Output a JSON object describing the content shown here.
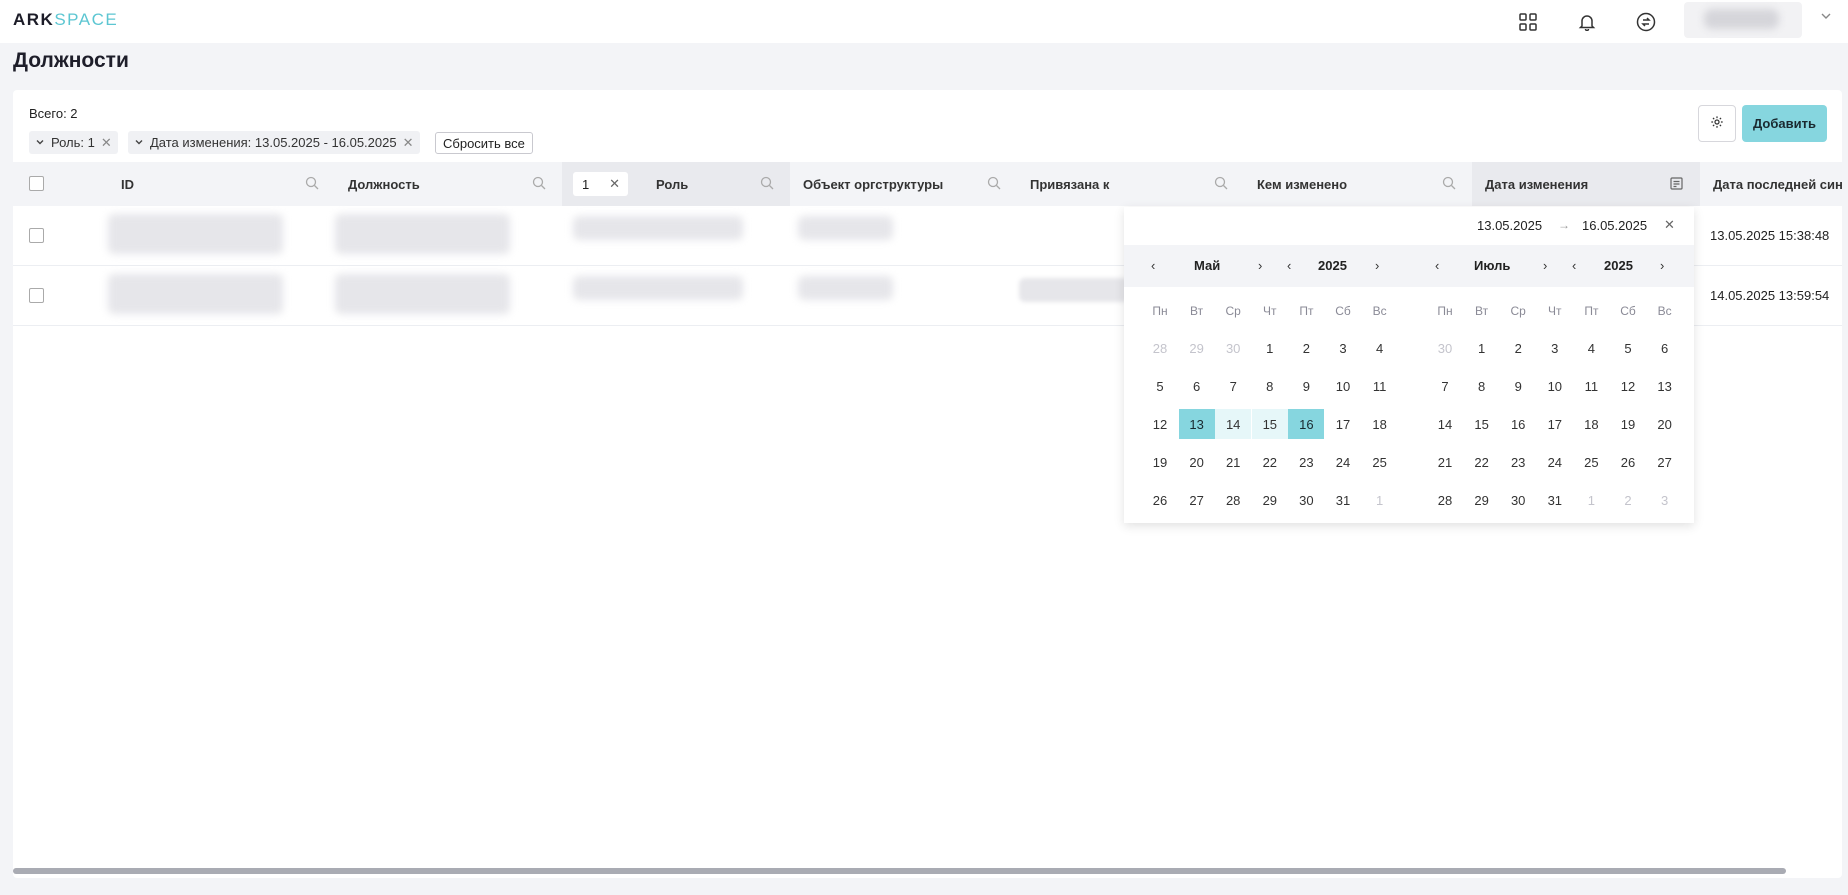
{
  "app": {
    "logo_bold": "ARK",
    "logo_light": "SPACE"
  },
  "topbar": {
    "icons": [
      "grid-icon",
      "bell-icon",
      "sync-icon"
    ]
  },
  "page": {
    "title": "Должности"
  },
  "toolbar": {
    "total": "Всего: 2",
    "chips": [
      {
        "label": "Роль: 1"
      },
      {
        "label": "Дата изменения: 13.05.2025 - 16.05.2025"
      }
    ],
    "reset_label": "Сбросить все",
    "add_label": "Добавить"
  },
  "table": {
    "columns": [
      "ID",
      "Должность",
      "Роль",
      "Объект оргструктуры",
      "Привязана к",
      "Кем изменено",
      "Дата изменения",
      "Дата последней син"
    ],
    "role_filter_value": "1",
    "rows": [
      {
        "date": "13.05.2025 15:38:48"
      },
      {
        "date": "14.05.2025 13:59:54"
      }
    ]
  },
  "calendar": {
    "from": "13.05.2025",
    "arrow": "→",
    "to": "16.05.2025",
    "left": {
      "month": "Май",
      "year": "2025"
    },
    "right": {
      "month": "Июль",
      "year": "2025"
    },
    "weekdays": [
      "Пн",
      "Вт",
      "Ср",
      "Чт",
      "Пт",
      "Сб",
      "Вс"
    ],
    "left_days": [
      [
        "28",
        "29",
        "30",
        "1",
        "2",
        "3",
        "4"
      ],
      [
        "5",
        "6",
        "7",
        "8",
        "9",
        "10",
        "11"
      ],
      [
        "12",
        "13",
        "14",
        "15",
        "16",
        "17",
        "18"
      ],
      [
        "19",
        "20",
        "21",
        "22",
        "23",
        "24",
        "25"
      ],
      [
        "26",
        "27",
        "28",
        "29",
        "30",
        "31",
        "1"
      ]
    ],
    "right_days": [
      [
        "30",
        "1",
        "2",
        "3",
        "4",
        "5",
        "6"
      ],
      [
        "7",
        "8",
        "9",
        "10",
        "11",
        "12",
        "13"
      ],
      [
        "14",
        "15",
        "16",
        "17",
        "18",
        "19",
        "20"
      ],
      [
        "21",
        "22",
        "23",
        "24",
        "25",
        "26",
        "27"
      ],
      [
        "28",
        "29",
        "30",
        "31",
        "1",
        "2",
        "3"
      ]
    ]
  },
  "colors": {
    "accent": "#86d6df",
    "range": "#e6f7f9",
    "logo_light": "#5cc6d2"
  }
}
